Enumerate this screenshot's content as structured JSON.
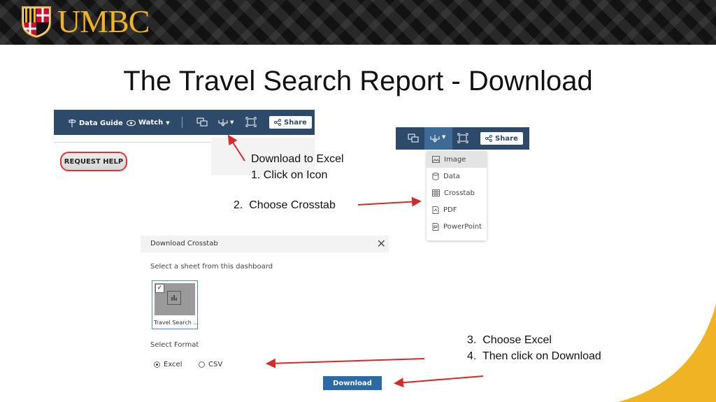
{
  "header": {
    "logo_text": "UMBC",
    "logo_icon": "umbc-shield-icon"
  },
  "slide": {
    "title": "The Travel Search Report - Download"
  },
  "toolbar_screenshot": {
    "data_guide_label": "Data Guide",
    "watch_label": "Watch",
    "share_label": "Share",
    "request_help_label": "REQUEST HELP",
    "icons": [
      "signpost-icon",
      "eye-icon",
      "comment-icon",
      "download-icon",
      "fullscreen-icon",
      "share-icon"
    ]
  },
  "notes": {
    "step1": "Download to Excel\n1. Click on Icon",
    "step2": "2.  Choose Crosstab",
    "step34": "3.  Choose Excel\n4.  Then click on Download"
  },
  "download_menu": {
    "share_label": "Share",
    "items": [
      {
        "label": "Image",
        "icon": "image-icon",
        "highlighted": true
      },
      {
        "label": "Data",
        "icon": "database-icon",
        "highlighted": false
      },
      {
        "label": "Crosstab",
        "icon": "table-icon",
        "highlighted": false
      },
      {
        "label": "PDF",
        "icon": "pdf-icon",
        "highlighted": false
      },
      {
        "label": "PowerPoint",
        "icon": "powerpoint-icon",
        "highlighted": false
      }
    ]
  },
  "dialog": {
    "title": "Download Crosstab",
    "close_glyph": "✕",
    "select_sheet_label": "Select a sheet from this dashboard",
    "sheet_name": "Travel Search ...",
    "select_format_label": "Select Format",
    "format_options": [
      {
        "label": "Excel",
        "selected": true
      },
      {
        "label": "CSV",
        "selected": false
      }
    ],
    "download_label": "Download"
  },
  "colors": {
    "tableau_navy": "#2d4a6b",
    "umbc_gold": "#f0b323",
    "annotation_red": "#d42a2a"
  }
}
